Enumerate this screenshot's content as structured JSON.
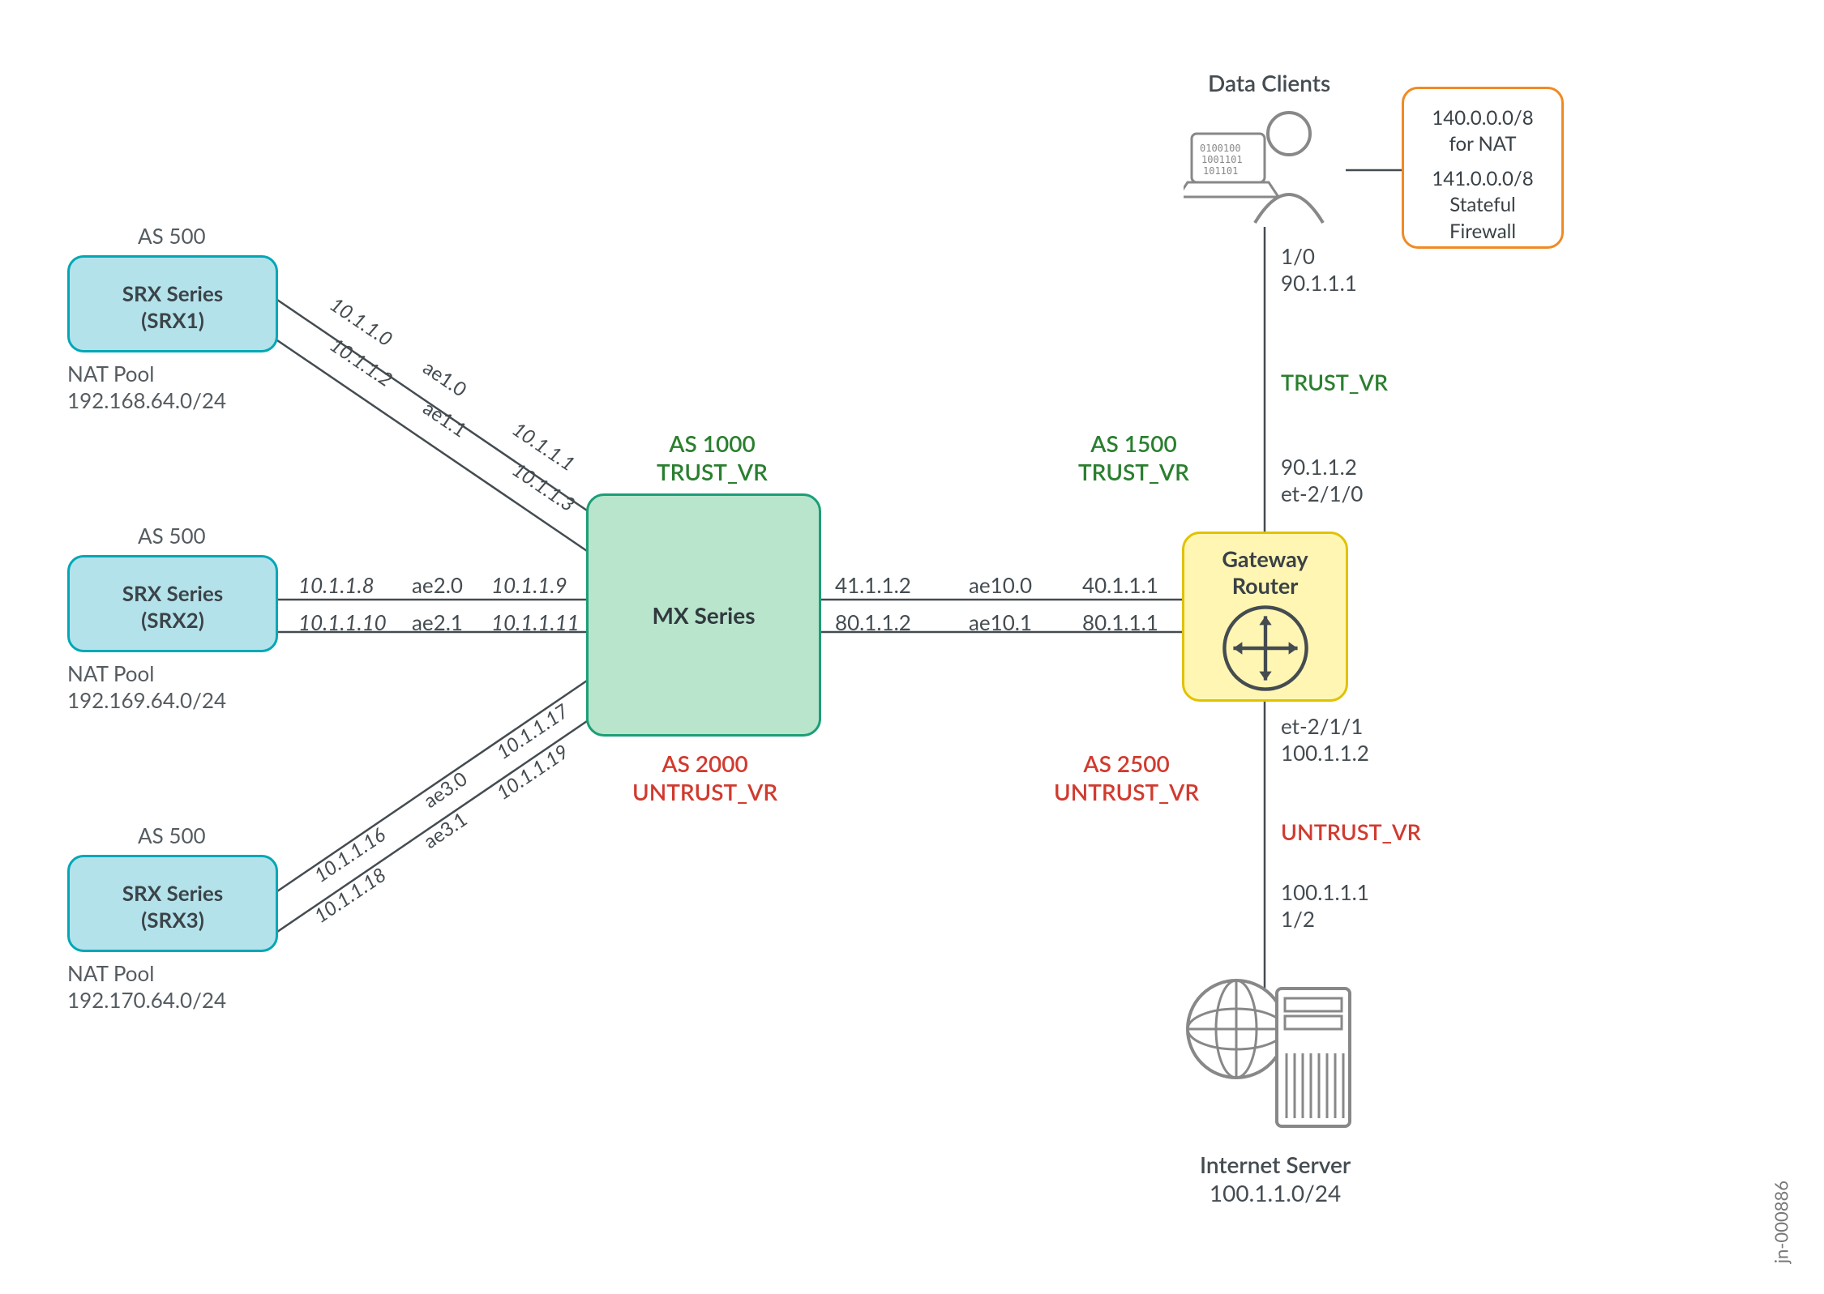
{
  "jn_id": "jn-000886",
  "mx": {
    "label": "MX Series",
    "as_top": "AS 1000",
    "vr_top": "TRUST_VR",
    "as_bot": "AS 2000",
    "vr_bot": "UNTRUST_VR"
  },
  "gw": {
    "label1": "Gateway",
    "label2": "Router",
    "as_top": "AS 1500",
    "vr_top": "TRUST_VR",
    "as_bot": "AS 2500",
    "vr_bot": "UNTRUST_VR"
  },
  "srx1": {
    "as": "AS 500",
    "line1": "SRX Series",
    "line2": "(SRX1)",
    "pool1": "NAT Pool",
    "pool2": "192.168.64.0/24"
  },
  "srx2": {
    "as": "AS 500",
    "line1": "SRX Series",
    "line2": "(SRX2)",
    "pool1": "NAT Pool",
    "pool2": "192.169.64.0/24"
  },
  "srx3": {
    "as": "AS 500",
    "line1": "SRX Series",
    "line2": "(SRX3)",
    "pool1": "NAT Pool",
    "pool2": "192.170.64.0/24"
  },
  "nat": {
    "l1": "140.0.0.0/8",
    "l2": "for NAT",
    "l3": "141.0.0.0/8",
    "l4": "Stateful",
    "l5": "Firewall"
  },
  "dc": {
    "title": "Data Clients",
    "if": "1/0",
    "ip": "90.1.1.1",
    "vr": "TRUST_VR"
  },
  "is": {
    "title": "Internet Server",
    "subnet": "100.1.1.0/24",
    "ip": "100.1.1.1",
    "if": "1/2",
    "vr": "UNTRUST_VR"
  },
  "gw_top": {
    "ip": "90.1.1.2",
    "if": "et-2/1/0"
  },
  "gw_bot": {
    "if": "et-2/1/1",
    "ip": "100.1.1.2"
  },
  "mx_right": {
    "top": "41.1.1.2",
    "bot": "80.1.1.2"
  },
  "ae10": {
    "top": "ae10.0",
    "bot": "ae10.1"
  },
  "gw_left": {
    "top": "40.1.1.1",
    "bot": "80.1.1.1"
  },
  "srx2_right": {
    "top": "10.1.1.8",
    "bot": "10.1.1.10"
  },
  "ae2": {
    "top": "ae2.0",
    "bot": "ae2.1"
  },
  "mx_left2": {
    "top": "10.1.1.9",
    "bot": "10.1.1.11"
  },
  "srx1_ip": {
    "a": "10.1.1.0",
    "b": "10.1.1.2"
  },
  "ae1": {
    "a": "ae1.0",
    "b": "ae1.1"
  },
  "mx_left1": {
    "a": "10.1.1.1",
    "b": "10.1.1.3"
  },
  "srx3_ip": {
    "a": "10.1.1.16",
    "b": "10.1.1.18"
  },
  "ae3": {
    "a": "ae3.0",
    "b": "ae3.1"
  },
  "mx_left3": {
    "a": "10.1.1.17",
    "b": "10.1.1.19"
  }
}
